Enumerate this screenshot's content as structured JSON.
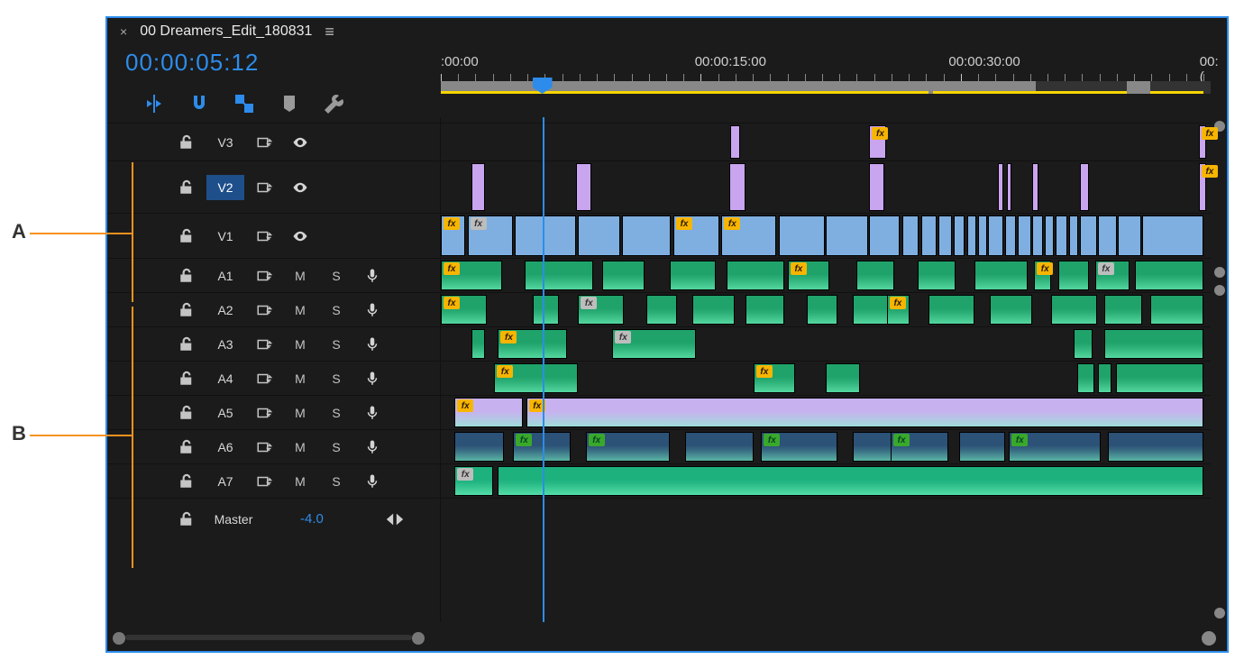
{
  "header": {
    "sequence_name": "00 Dreamers_Edit_180831",
    "close_glyph": "×",
    "menu_glyph": "≡"
  },
  "timecode_display": "00:00:05:12",
  "toolbelt_icons": [
    "insert-overwrite-icon",
    "snap-icon",
    "linked-selection-icon",
    "marker-icon",
    "wrench-icon"
  ],
  "ruler": {
    "marks": [
      {
        "label": ":00:00",
        "pos": 0.0
      },
      {
        "label": "00:00:15:00",
        "pos": 0.333
      },
      {
        "label": "00:00:30:00",
        "pos": 0.666
      },
      {
        "label": "00:(",
        "pos": 0.995
      }
    ],
    "tick_count": 45
  },
  "workarea": {
    "gray_segments": [
      [
        0.0,
        0.78
      ],
      [
        0.9,
        0.93
      ]
    ],
    "yellow_segments": [
      [
        0.0,
        0.64
      ],
      [
        0.645,
        0.9
      ],
      [
        0.93,
        1.0
      ]
    ]
  },
  "playhead_frac": 0.133,
  "annotations": {
    "A": "A",
    "B": "B"
  },
  "video_tracks": [
    {
      "id": "V3",
      "selected": false,
      "height": 42,
      "clips": [
        {
          "x": 0.38,
          "w": 0.012,
          "color": "c-purple"
        },
        {
          "x": 0.562,
          "w": 0.022,
          "color": "c-purple",
          "fx": "y"
        },
        {
          "x": 0.994,
          "w": 0.01,
          "color": "c-purple",
          "fx": "y"
        }
      ]
    },
    {
      "id": "V2",
      "selected": true,
      "height": 58,
      "clips": [
        {
          "x": 0.04,
          "w": 0.018,
          "color": "c-purple"
        },
        {
          "x": 0.177,
          "w": 0.02,
          "color": "c-purple"
        },
        {
          "x": 0.378,
          "w": 0.022,
          "color": "c-purple"
        },
        {
          "x": 0.562,
          "w": 0.02,
          "color": "c-purple"
        },
        {
          "x": 0.73,
          "w": 0.008,
          "color": "c-purple"
        },
        {
          "x": 0.742,
          "w": 0.006,
          "color": "c-purple"
        },
        {
          "x": 0.776,
          "w": 0.008,
          "color": "c-purple"
        },
        {
          "x": 0.838,
          "w": 0.012,
          "color": "c-purple"
        },
        {
          "x": 0.994,
          "w": 0.01,
          "color": "c-purple",
          "fx": "y"
        }
      ]
    },
    {
      "id": "V1",
      "selected": false,
      "height": 50,
      "clips": [
        {
          "x": 0.0,
          "w": 0.032,
          "color": "c-blue",
          "fx": "y"
        },
        {
          "x": 0.035,
          "w": 0.06,
          "color": "c-blue",
          "fx": "gr"
        },
        {
          "x": 0.097,
          "w": 0.08,
          "color": "c-blue"
        },
        {
          "x": 0.18,
          "w": 0.055,
          "color": "c-blue"
        },
        {
          "x": 0.237,
          "w": 0.065,
          "color": "c-blue"
        },
        {
          "x": 0.305,
          "w": 0.06,
          "color": "c-blue",
          "fx": "y"
        },
        {
          "x": 0.368,
          "w": 0.072,
          "color": "c-blue",
          "fx": "y"
        },
        {
          "x": 0.443,
          "w": 0.06,
          "color": "c-blue"
        },
        {
          "x": 0.505,
          "w": 0.055,
          "color": "c-blue"
        },
        {
          "x": 0.562,
          "w": 0.04,
          "color": "c-blue"
        },
        {
          "x": 0.605,
          "w": 0.022,
          "color": "c-blue"
        },
        {
          "x": 0.63,
          "w": 0.02,
          "color": "c-blue"
        },
        {
          "x": 0.652,
          "w": 0.018,
          "color": "c-blue"
        },
        {
          "x": 0.672,
          "w": 0.015,
          "color": "c-blue"
        },
        {
          "x": 0.69,
          "w": 0.012,
          "color": "c-blue"
        },
        {
          "x": 0.704,
          "w": 0.012,
          "color": "c-blue"
        },
        {
          "x": 0.718,
          "w": 0.02,
          "color": "c-blue"
        },
        {
          "x": 0.74,
          "w": 0.014,
          "color": "c-blue"
        },
        {
          "x": 0.756,
          "w": 0.018,
          "color": "c-blue"
        },
        {
          "x": 0.776,
          "w": 0.014,
          "color": "c-blue"
        },
        {
          "x": 0.792,
          "w": 0.012,
          "color": "c-blue"
        },
        {
          "x": 0.806,
          "w": 0.016,
          "color": "c-blue"
        },
        {
          "x": 0.824,
          "w": 0.012,
          "color": "c-blue"
        },
        {
          "x": 0.838,
          "w": 0.022,
          "color": "c-blue"
        },
        {
          "x": 0.862,
          "w": 0.024,
          "color": "c-blue"
        },
        {
          "x": 0.888,
          "w": 0.03,
          "color": "c-blue"
        },
        {
          "x": 0.92,
          "w": 0.08,
          "color": "c-blue"
        }
      ]
    }
  ],
  "audio_tracks": [
    {
      "id": "A1",
      "height": 38,
      "clips": [
        {
          "x": 0.0,
          "w": 0.08,
          "color": "c-green",
          "fx": "y"
        },
        {
          "x": 0.11,
          "w": 0.09,
          "color": "c-green"
        },
        {
          "x": 0.212,
          "w": 0.055,
          "color": "c-green"
        },
        {
          "x": 0.3,
          "w": 0.06,
          "color": "c-green"
        },
        {
          "x": 0.375,
          "w": 0.075,
          "color": "c-green"
        },
        {
          "x": 0.455,
          "w": 0.055,
          "color": "c-green",
          "fx": "y"
        },
        {
          "x": 0.545,
          "w": 0.05,
          "color": "c-green"
        },
        {
          "x": 0.625,
          "w": 0.05,
          "color": "c-green"
        },
        {
          "x": 0.7,
          "w": 0.07,
          "color": "c-green"
        },
        {
          "x": 0.778,
          "w": 0.022,
          "color": "c-green",
          "fx": "y"
        },
        {
          "x": 0.81,
          "w": 0.04,
          "color": "c-green"
        },
        {
          "x": 0.858,
          "w": 0.045,
          "color": "c-green",
          "fx": "gr"
        },
        {
          "x": 0.91,
          "w": 0.09,
          "color": "c-green"
        }
      ]
    },
    {
      "id": "A2",
      "height": 38,
      "clips": [
        {
          "x": 0.0,
          "w": 0.06,
          "color": "c-green",
          "fx": "y"
        },
        {
          "x": 0.12,
          "w": 0.035,
          "color": "c-green"
        },
        {
          "x": 0.18,
          "w": 0.06,
          "color": "c-green",
          "fx": "gr"
        },
        {
          "x": 0.27,
          "w": 0.04,
          "color": "c-green"
        },
        {
          "x": 0.33,
          "w": 0.055,
          "color": "c-green"
        },
        {
          "x": 0.4,
          "w": 0.05,
          "color": "c-green"
        },
        {
          "x": 0.48,
          "w": 0.04,
          "color": "c-green"
        },
        {
          "x": 0.54,
          "w": 0.05,
          "color": "c-green"
        },
        {
          "x": 0.585,
          "w": 0.03,
          "color": "c-green",
          "fx": "y"
        },
        {
          "x": 0.64,
          "w": 0.06,
          "color": "c-green"
        },
        {
          "x": 0.72,
          "w": 0.055,
          "color": "c-green"
        },
        {
          "x": 0.8,
          "w": 0.06,
          "color": "c-green"
        },
        {
          "x": 0.87,
          "w": 0.05,
          "color": "c-green"
        },
        {
          "x": 0.93,
          "w": 0.07,
          "color": "c-green"
        }
      ]
    },
    {
      "id": "A3",
      "height": 38,
      "clips": [
        {
          "x": 0.04,
          "w": 0.018,
          "color": "c-green"
        },
        {
          "x": 0.075,
          "w": 0.09,
          "color": "c-green",
          "fx": "y"
        },
        {
          "x": 0.225,
          "w": 0.11,
          "color": "c-green",
          "fx": "gr"
        },
        {
          "x": 0.83,
          "w": 0.025,
          "color": "c-green"
        },
        {
          "x": 0.87,
          "w": 0.13,
          "color": "c-green"
        }
      ]
    },
    {
      "id": "A4",
      "height": 38,
      "clips": [
        {
          "x": 0.07,
          "w": 0.11,
          "color": "c-green",
          "fx": "y"
        },
        {
          "x": 0.41,
          "w": 0.055,
          "color": "c-green",
          "fx": "y"
        },
        {
          "x": 0.505,
          "w": 0.045,
          "color": "c-green"
        },
        {
          "x": 0.835,
          "w": 0.022,
          "color": "c-green"
        },
        {
          "x": 0.862,
          "w": 0.018,
          "color": "c-green"
        },
        {
          "x": 0.885,
          "w": 0.115,
          "color": "c-green"
        }
      ]
    },
    {
      "id": "A5",
      "height": 38,
      "clips": [
        {
          "x": 0.018,
          "w": 0.09,
          "color": "c-lav",
          "fx": "y"
        },
        {
          "x": 0.112,
          "w": 0.888,
          "color": "c-lav",
          "fx": "y"
        }
      ]
    },
    {
      "id": "A6",
      "height": 38,
      "clips": [
        {
          "x": 0.018,
          "w": 0.065,
          "color": "c-navy"
        },
        {
          "x": 0.095,
          "w": 0.075,
          "color": "c-navy",
          "fx": "g"
        },
        {
          "x": 0.19,
          "w": 0.11,
          "color": "c-navy",
          "fx": "g"
        },
        {
          "x": 0.32,
          "w": 0.09,
          "color": "c-navy"
        },
        {
          "x": 0.42,
          "w": 0.1,
          "color": "c-navy",
          "fx": "g"
        },
        {
          "x": 0.54,
          "w": 0.085,
          "color": "c-navy"
        },
        {
          "x": 0.59,
          "w": 0.075,
          "color": "c-navy",
          "fx": "g"
        },
        {
          "x": 0.68,
          "w": 0.06,
          "color": "c-navy"
        },
        {
          "x": 0.745,
          "w": 0.12,
          "color": "c-navy",
          "fx": "g"
        },
        {
          "x": 0.875,
          "w": 0.125,
          "color": "c-navy"
        }
      ]
    },
    {
      "id": "A7",
      "height": 38,
      "clips": [
        {
          "x": 0.018,
          "w": 0.05,
          "color": "c-teal",
          "fx": "gr"
        },
        {
          "x": 0.075,
          "w": 0.925,
          "color": "c-teal"
        }
      ]
    }
  ],
  "master": {
    "label": "Master",
    "value": "-4.0"
  },
  "mute_label": "M",
  "solo_label": "S"
}
